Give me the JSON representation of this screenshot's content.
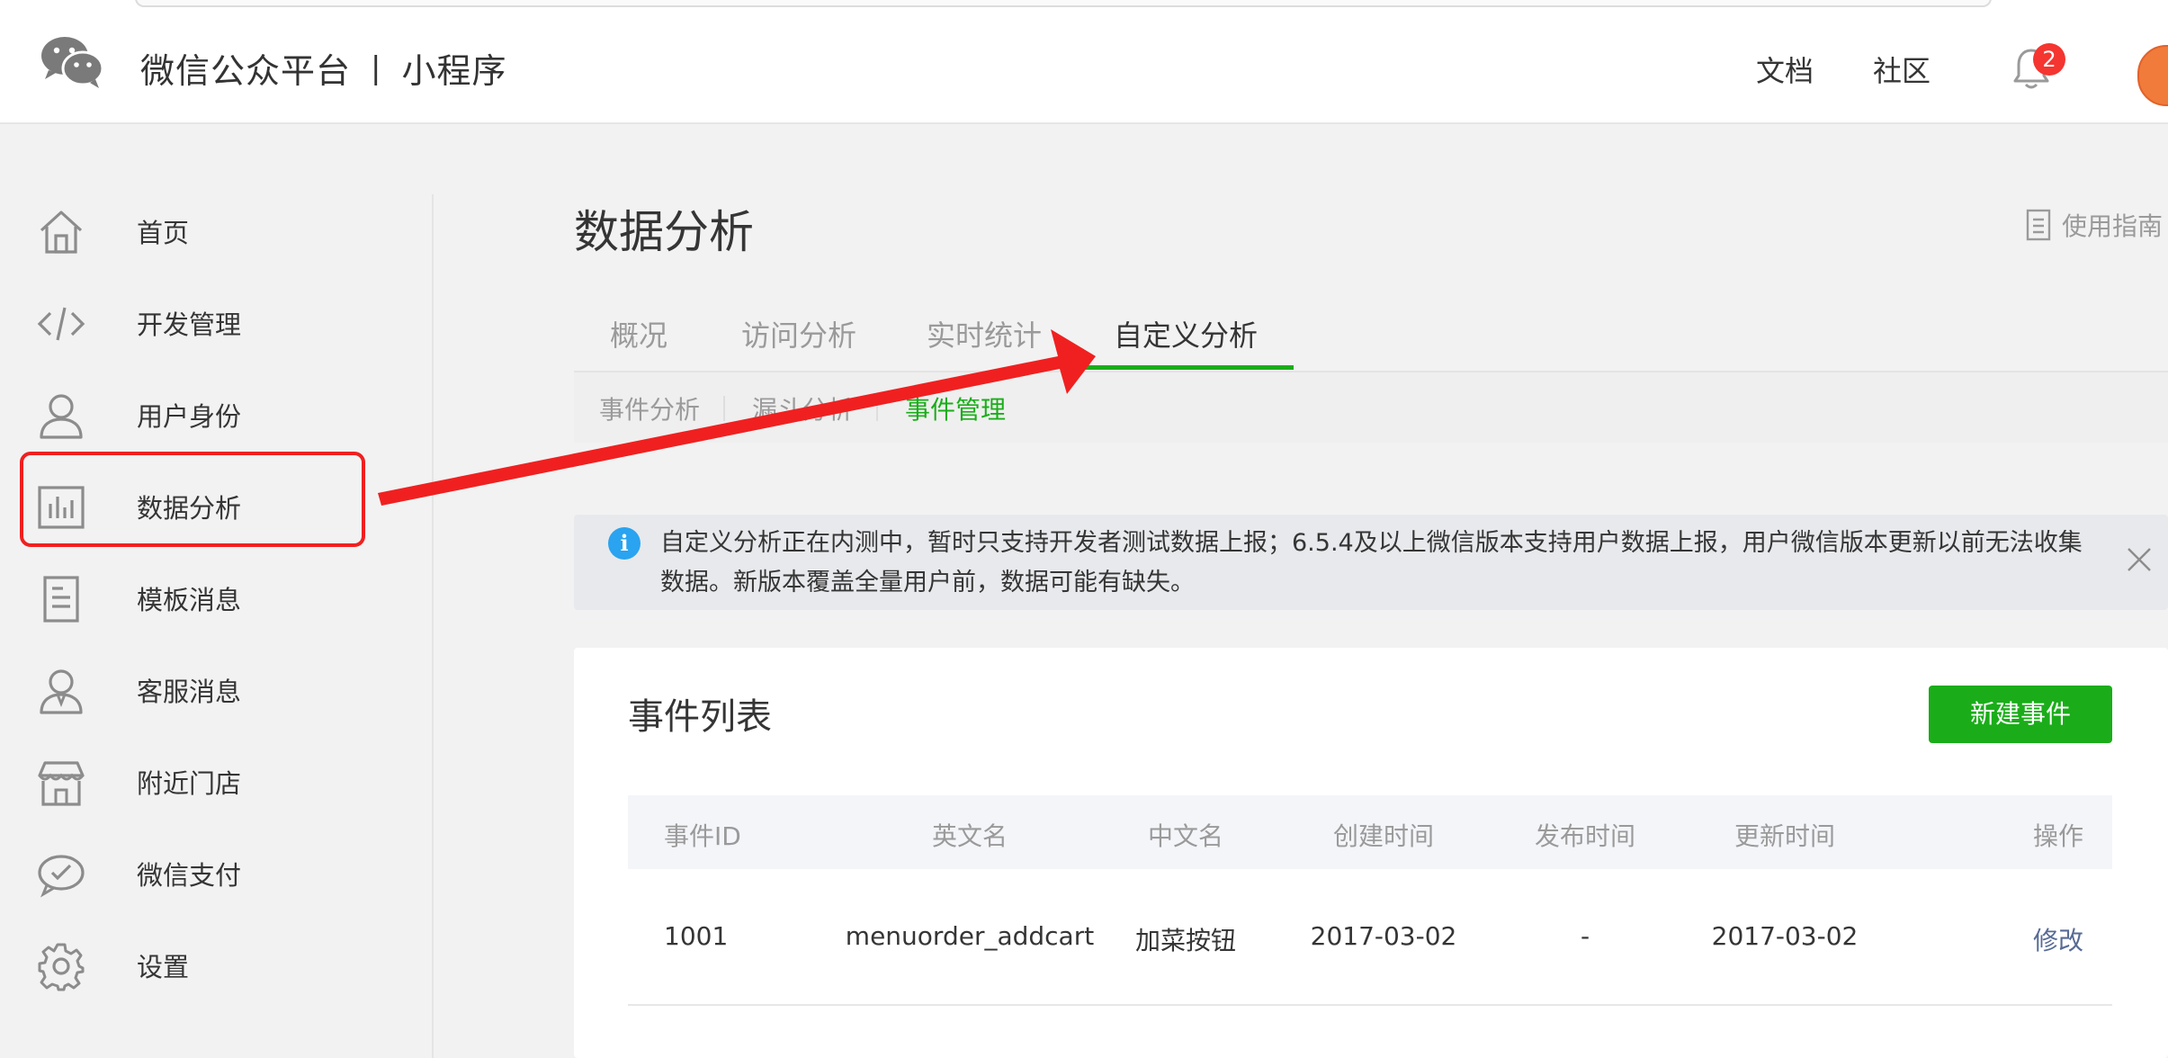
{
  "header": {
    "brand_name": "微信公众平台",
    "brand_sep": "|",
    "brand_product": "小程序",
    "nav_docs": "文档",
    "nav_community": "社区",
    "notification_count": "2"
  },
  "sidebar": {
    "items": [
      {
        "label": "首页",
        "icon": "home-icon"
      },
      {
        "label": "开发管理",
        "icon": "code-icon"
      },
      {
        "label": "用户身份",
        "icon": "user-icon"
      },
      {
        "label": "数据分析",
        "icon": "bar-chart-icon"
      },
      {
        "label": "模板消息",
        "icon": "document-icon"
      },
      {
        "label": "客服消息",
        "icon": "customer-service-icon"
      },
      {
        "label": "附近门店",
        "icon": "store-icon"
      },
      {
        "label": "微信支付",
        "icon": "payment-icon"
      },
      {
        "label": "设置",
        "icon": "gear-icon"
      }
    ],
    "active_index": 3
  },
  "main": {
    "title": "数据分析",
    "guide_label": "使用指南",
    "tabs": [
      {
        "label": "概况"
      },
      {
        "label": "访问分析"
      },
      {
        "label": "实时统计"
      },
      {
        "label": "自定义分析"
      }
    ],
    "active_tab_index": 3,
    "subtabs": [
      {
        "label": "事件分析"
      },
      {
        "label": "漏斗分析"
      },
      {
        "label": "事件管理"
      }
    ],
    "active_subtab_index": 2,
    "notice": "自定义分析正在内测中，暂时只支持开发者测试数据上报；6.5.4及以上微信版本支持用户数据上报，用户微信版本更新以前无法收集数据。新版本覆盖全量用户前，数据可能有缺失。",
    "events_card": {
      "title": "事件列表",
      "new_button": "新建事件",
      "columns": [
        "事件ID",
        "英文名",
        "中文名",
        "创建时间",
        "发布时间",
        "更新时间",
        "操作"
      ],
      "rows": [
        [
          "1001",
          "menuorder_addcart",
          "加菜按钮",
          "2017-03-02",
          "-",
          "2017-03-02",
          "修改"
        ]
      ]
    }
  },
  "colors": {
    "accent_green": "#1aad19",
    "annotation_red": "#f02020",
    "link_blue": "#576b95",
    "badge_red": "#f43530"
  }
}
